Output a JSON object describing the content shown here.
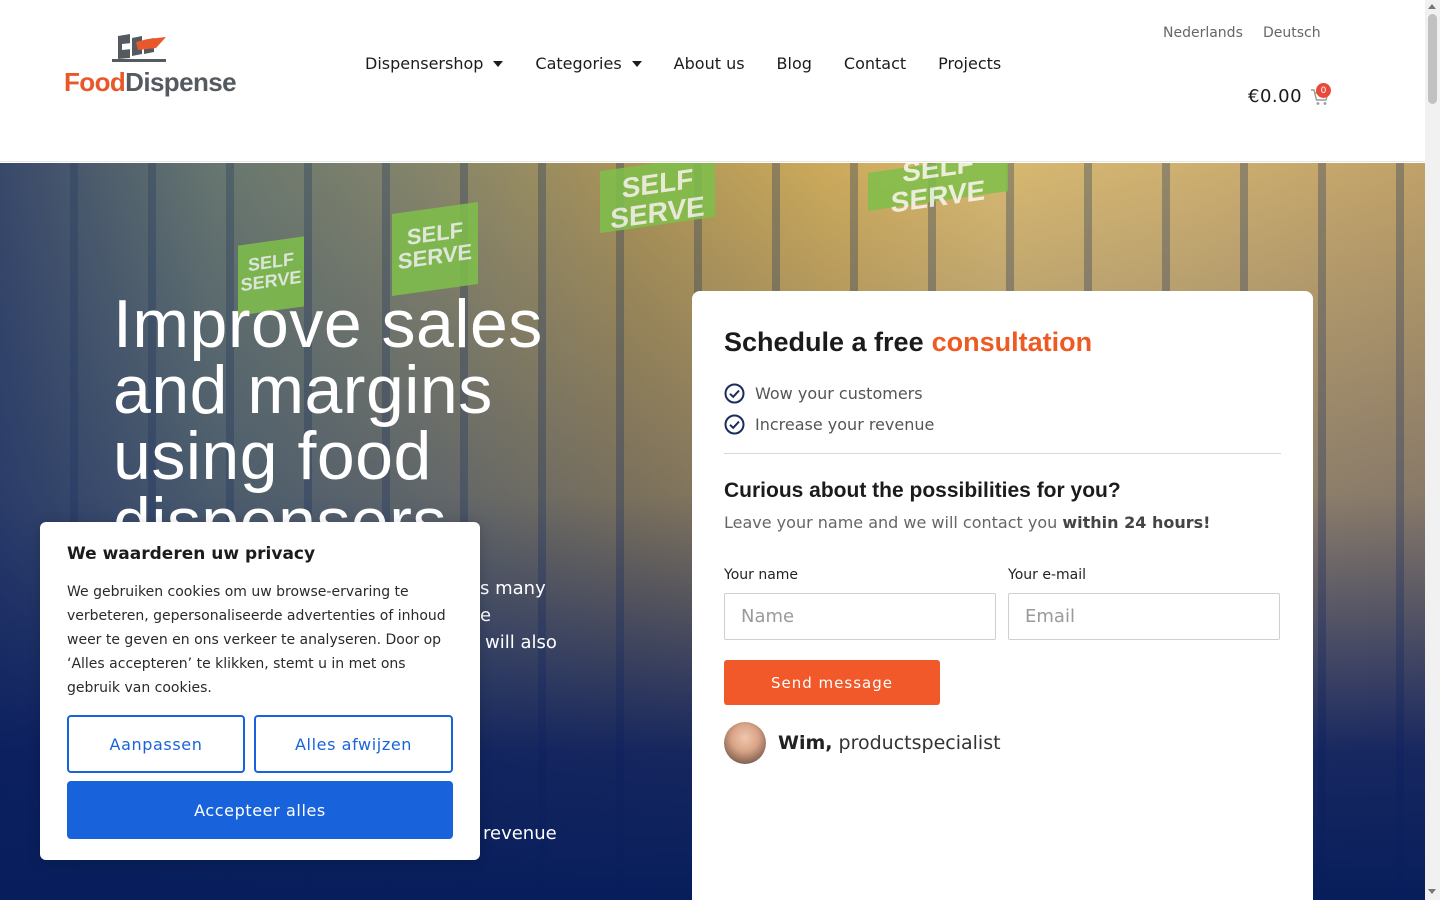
{
  "header": {
    "logo": {
      "word_a": "Food",
      "word_b": "Dispense"
    },
    "nav": [
      {
        "label": "Dispensershop",
        "has_dropdown": true
      },
      {
        "label": "Categories",
        "has_dropdown": true
      },
      {
        "label": "About us",
        "has_dropdown": false
      },
      {
        "label": "Blog",
        "has_dropdown": false
      },
      {
        "label": "Contact",
        "has_dropdown": false
      },
      {
        "label": "Projects",
        "has_dropdown": false
      }
    ],
    "languages": [
      "Nederlands",
      "Deutsch"
    ],
    "cart": {
      "amount": "€0.00",
      "count": "0",
      "icon": "cart-icon"
    }
  },
  "hero": {
    "title": "Improve sales and margins using food dispensers",
    "text_fragments": [
      "s many",
      "e",
      "will also",
      "revenue"
    ],
    "image_labels": [
      "SELF SERVE"
    ]
  },
  "form_card": {
    "title_main": "Schedule a free",
    "title_accent": "consultation",
    "benefits": [
      "Wow your customers",
      "Increase your revenue"
    ],
    "subtitle": "Curious about the possibilities for you?",
    "description_main": "Leave your name and we will contact you",
    "description_strong": "within 24 hours!",
    "name_label": "Your name",
    "name_placeholder": "Name",
    "email_label": "Your e-mail",
    "email_placeholder": "Email",
    "submit_label": "Send message",
    "specialist_name": "Wim,",
    "specialist_role": "productspecialist"
  },
  "cookie_banner": {
    "title": "We waarderen uw privacy",
    "body": "We gebruiken cookies om uw browse-ervaring te verbeteren, gepersonaliseerde advertenties of inhoud weer te geven en ons verkeer te analyseren. Door op ‘Alles accepteren’ te klikken, stemt u in met ons gebruik van cookies.",
    "customize_label": "Aanpassen",
    "reject_label": "Alles afwijzen",
    "accept_label": "Accepteer alles"
  },
  "colors": {
    "accent_orange": "#f1582a",
    "cookie_blue": "#1863dc",
    "hero_navy": "#071e5c",
    "check_navy": "#1b2c5e"
  }
}
